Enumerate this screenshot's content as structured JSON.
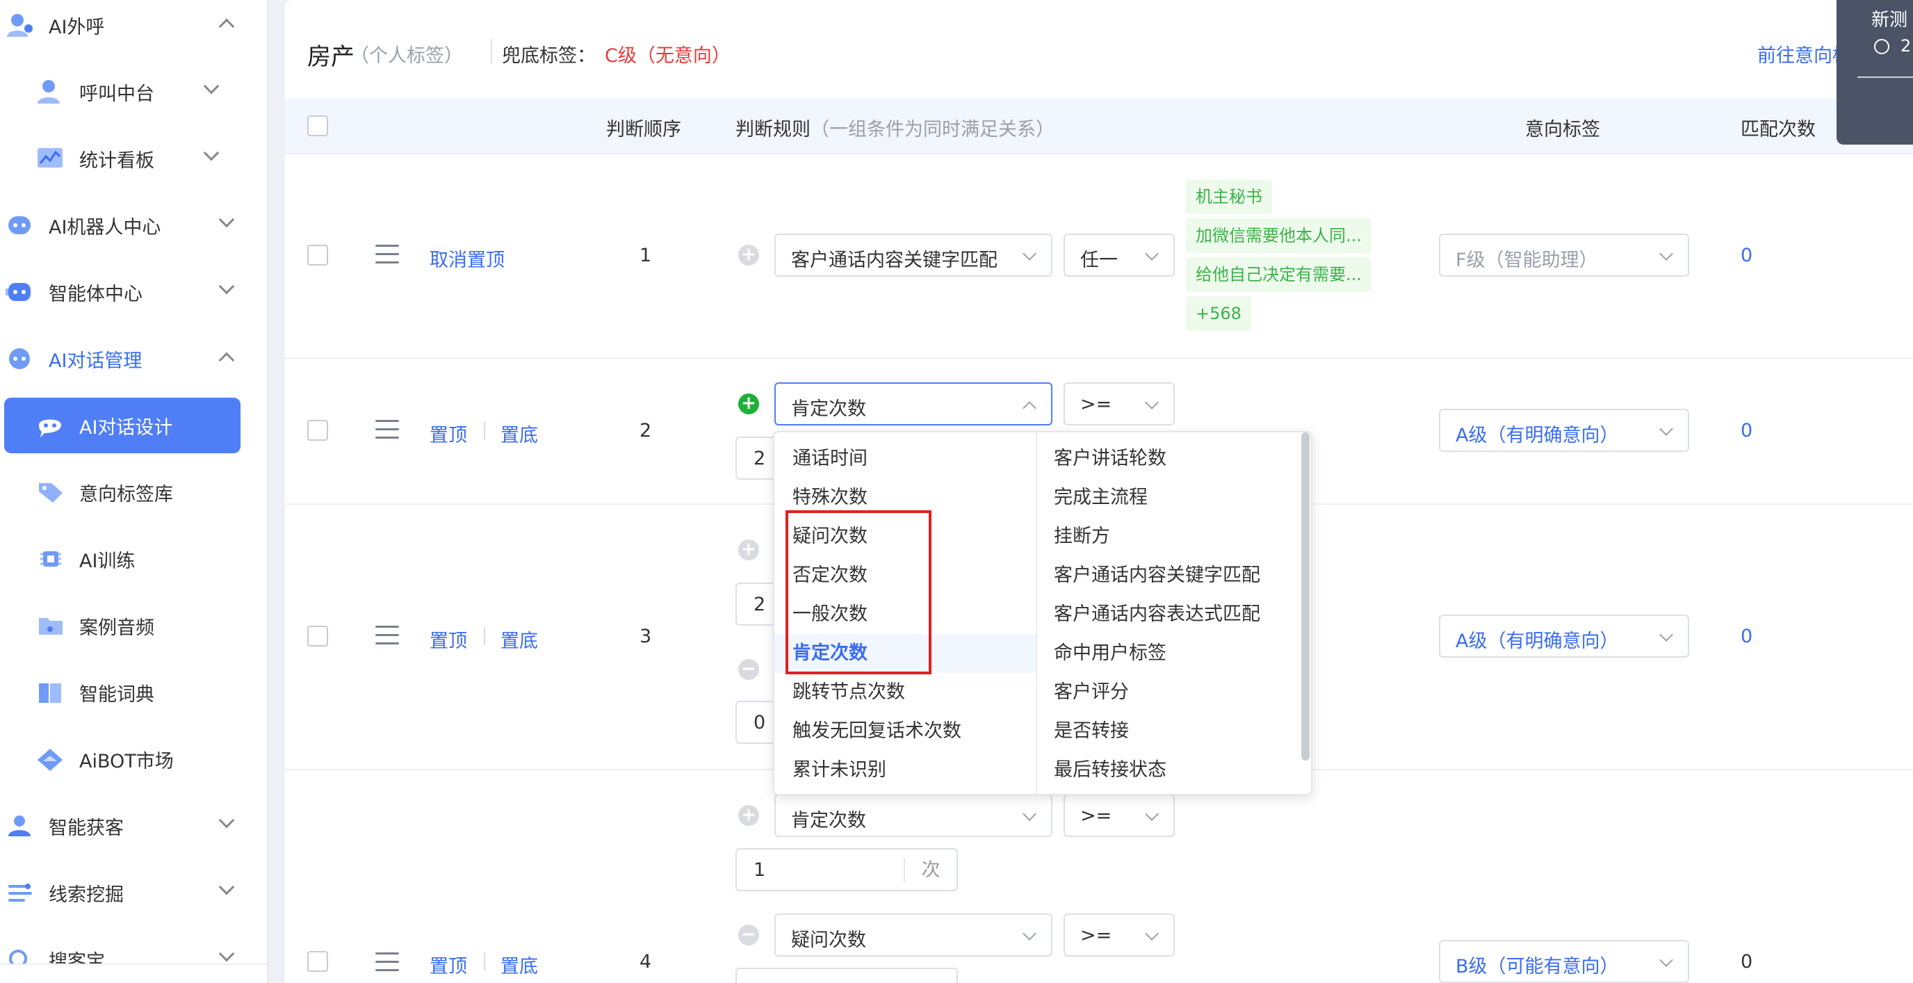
{
  "sidebar": {
    "items": [
      {
        "label": "AI外呼",
        "icon": "user-headset-icon",
        "chevron": "up"
      },
      {
        "label": "呼叫中台",
        "icon": "call-center-icon",
        "chevron": "down"
      },
      {
        "label": "统计看板",
        "icon": "dashboard-chart-icon",
        "chevron": "down"
      },
      {
        "label": "AI机器人中心",
        "icon": "robot-icon",
        "chevron": "down"
      },
      {
        "label": "智能体中心",
        "icon": "agent-icon",
        "chevron": "down"
      },
      {
        "label": "AI对话管理",
        "icon": "dialog-manage-icon",
        "chevron": "up"
      },
      {
        "label": "AI对话设计",
        "icon": "chat-bubble-icon"
      },
      {
        "label": "意向标签库",
        "icon": "tag-icon"
      },
      {
        "label": "AI训练",
        "icon": "chip-icon"
      },
      {
        "label": "案例音频",
        "icon": "audio-folder-icon"
      },
      {
        "label": "智能词典",
        "icon": "book-icon"
      },
      {
        "label": "AiBOT市场",
        "icon": "market-icon"
      },
      {
        "label": "智能获客",
        "icon": "acquire-icon",
        "chevron": "down"
      },
      {
        "label": "线索挖掘",
        "icon": "clue-icon",
        "chevron": "down"
      },
      {
        "label": "搜客宝",
        "icon": "search-customer-icon",
        "chevron": "down"
      }
    ]
  },
  "header": {
    "title": "房产",
    "title_sub": "（个人标签）",
    "fallback_label": "兜底标签：",
    "fallback_value": "C级（无意向）",
    "goto_link": "前往意向标签"
  },
  "toast": {
    "title": "新测",
    "time": "2"
  },
  "table": {
    "columns": {
      "order": "判断顺序",
      "rule": "判断规则",
      "rule_hint": "（一组条件为同时满足关系）",
      "tag": "意向标签",
      "count": "匹配次数"
    },
    "rows": [
      {
        "action1": "取消置顶",
        "order": "1",
        "cond1_field": "客户通话内容关键字匹配",
        "cond1_op": "任一",
        "keywords": [
          "机主秘书",
          "加微信需要他本人同...",
          "给他自己决定有需要...",
          "+568"
        ],
        "tag": "F级（智能助理）",
        "count": "0"
      },
      {
        "action1": "置顶",
        "action2": "置底",
        "order": "2",
        "cond1_field": "肯定次数",
        "cond1_op": ">=",
        "cond1_value": "2",
        "tag": "A级（有明确意向）",
        "count": "0"
      },
      {
        "action1": "置顶",
        "action2": "置底",
        "order": "3",
        "cond1_value": "2",
        "cond2_value": "0",
        "tag": "A级（有明确意向）",
        "count": "0"
      },
      {
        "action1": "置顶",
        "action2": "置底",
        "order": "4",
        "pre_field": "肯定次数",
        "pre_op": ">=",
        "pre_value": "1",
        "pre_unit": "次",
        "cond2_field": "疑问次数",
        "cond2_op": ">=",
        "tag": "B级（可能有意向）",
        "count": "0"
      }
    ]
  },
  "dropdown": {
    "left": [
      "通话时间",
      "特殊次数",
      "疑问次数",
      "否定次数",
      "一般次数",
      "肯定次数",
      "跳转节点次数",
      "触发无回复话术次数",
      "累计未识别"
    ],
    "right": [
      "客户讲话轮数",
      "完成主流程",
      "挂断方",
      "客户通话内容关键字匹配",
      "客户通话内容表达式匹配",
      "命中用户标签",
      "客户评分",
      "是否转接",
      "最后转接状态"
    ],
    "selected": "肯定次数"
  }
}
